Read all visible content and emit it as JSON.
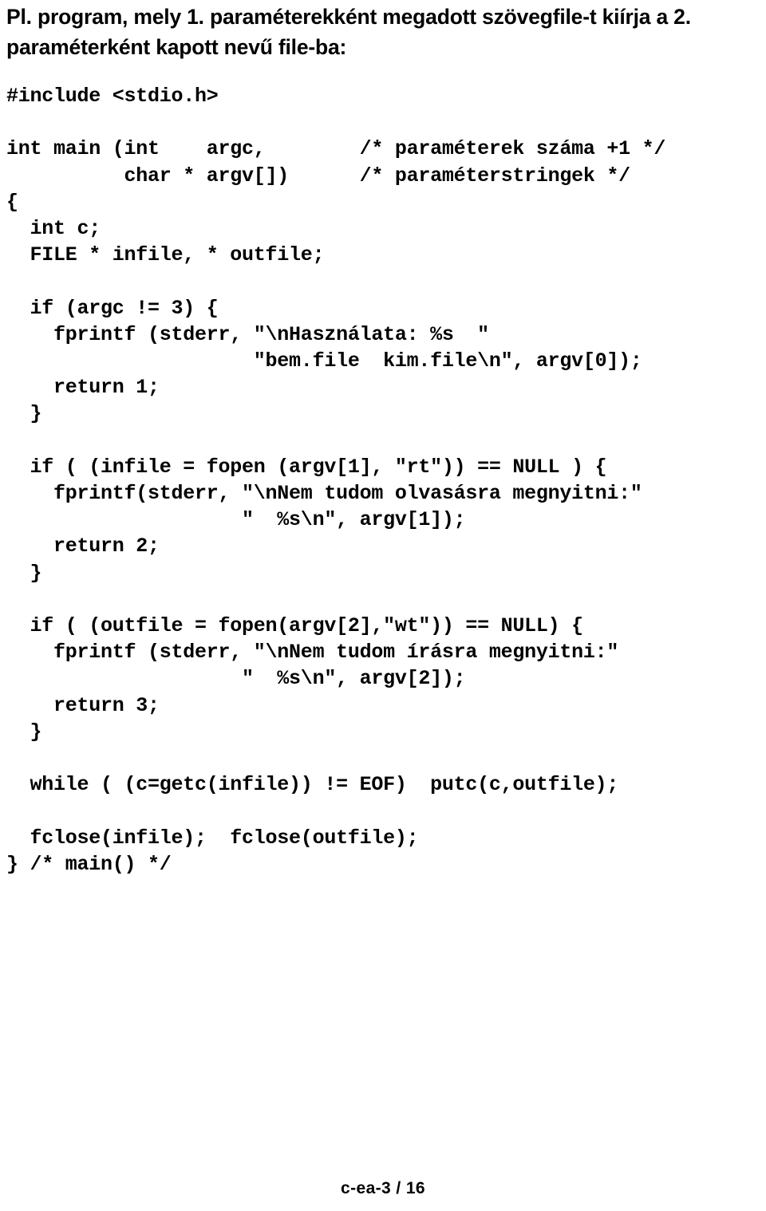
{
  "heading": {
    "lines": [
      "Pl. program, mely 1. paraméterekként megadott szövegfile-t kiírja a 2.",
      "paraméterként kapott nevű file-ba:"
    ]
  },
  "code": {
    "language": "c",
    "lines": [
      "#include <stdio.h>",
      "",
      "int main (int    argc,        /* paraméterek száma +1 */",
      "          char * argv[])      /* paraméterstringek */",
      "{",
      "  int c;",
      "  FILE * infile, * outfile;",
      "",
      "  if (argc != 3) {",
      "    fprintf (stderr, \"\\nHasználata: %s  \"",
      "                     \"bem.file  kim.file\\n\", argv[0]);",
      "    return 1;",
      "  }",
      "",
      "  if ( (infile = fopen (argv[1], \"rt\")) == NULL ) {",
      "    fprintf(stderr, \"\\nNem tudom olvasásra megnyitni:\"",
      "                    \"  %s\\n\", argv[1]);",
      "    return 2;",
      "  }",
      "",
      "  if ( (outfile = fopen(argv[2],\"wt\")) == NULL) {",
      "    fprintf (stderr, \"\\nNem tudom írásra megnyitni:\"",
      "                    \"  %s\\n\", argv[2]);",
      "    return 3;",
      "  }",
      "",
      "  while ( (c=getc(infile)) != EOF)  putc(c,outfile);",
      "",
      "  fclose(infile);  fclose(outfile);",
      "} /* main() */"
    ]
  },
  "footer": {
    "text": "c-ea-3 / 16"
  },
  "colors": {
    "text": "#000000",
    "background": "#ffffff"
  }
}
